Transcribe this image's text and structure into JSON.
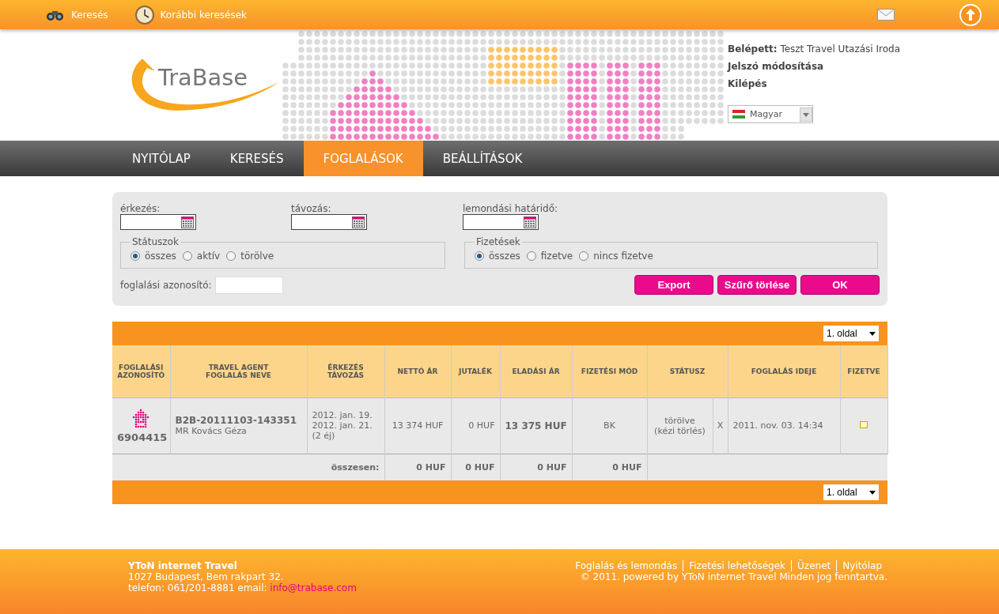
{
  "topbar": {
    "links": [
      {
        "label": "Keresés",
        "kind": "binoculars"
      },
      {
        "label": "Korábbi keresések",
        "kind": "clock"
      }
    ]
  },
  "header": {
    "logo": "TraBase",
    "logged_in_label": "Belépett:",
    "logged_in_user": "Teszt Travel Utazási Iroda",
    "links": [
      "Jelszó módosítása",
      "Kilépés"
    ],
    "language": "Magyar"
  },
  "nav": [
    {
      "label": "NYITÓLAP",
      "selected": false
    },
    {
      "label": "KERESÉS",
      "selected": false
    },
    {
      "label": "FOGLALÁSOK",
      "selected": true
    },
    {
      "label": "BEÁLLÍTÁSOK",
      "selected": false
    }
  ],
  "filters": {
    "dates": [
      {
        "label": "érkezés:"
      },
      {
        "label": "távozás:"
      },
      {
        "label": "lemondási határidő:"
      }
    ],
    "groups": [
      {
        "legend": "Státuszok",
        "options": [
          {
            "label": "összes",
            "selected": true
          },
          {
            "label": "aktív",
            "selected": false
          },
          {
            "label": "törölve",
            "selected": false
          }
        ]
      },
      {
        "legend": "Fizetések",
        "options": [
          {
            "label": "összes",
            "selected": true
          },
          {
            "label": "fizetve",
            "selected": false
          },
          {
            "label": "nincs fizetve",
            "selected": false
          }
        ]
      }
    ],
    "id_label": "foglalási azonosító:",
    "buttons": [
      "Export",
      "Szűrő törlése",
      "OK"
    ]
  },
  "pager": {
    "top": "1. oldal",
    "bottom": "1. oldal"
  },
  "table": {
    "columns": [
      [
        "FOGLALÁSI",
        "AZONOSÍTÓ"
      ],
      [
        "TRAVEL AGENT",
        "FOGLALÁS NEVE"
      ],
      [
        "ÉRKEZÉS",
        "TÁVOZÁS"
      ],
      [
        "NETTÓ ÁR"
      ],
      [
        "JUTALÉK"
      ],
      [
        "ELADÁSI ÁR"
      ],
      [
        "FIZETÉSI MÓD"
      ],
      [
        "STÁTUSZ"
      ],
      [
        "FOGLALÁS IDEJE"
      ],
      [
        "FIZETVE"
      ]
    ],
    "rows": [
      {
        "id": "6904415",
        "code": "B2B-20111103-143351",
        "name": "MR Kovács Géza",
        "dates": [
          "2012. jan. 19.",
          "2012. jan. 21.",
          "(2 éj)"
        ],
        "net": "13 374 HUF",
        "commission": "0 HUF",
        "sale": "13 375 HUF",
        "payment": "BK",
        "status": [
          "törölve",
          "(kézi törlés)"
        ],
        "mark": "X",
        "booked": "2011. nov. 03. 14:34",
        "paid": false
      }
    ],
    "totals": {
      "label": "összesen:",
      "values": [
        "0 HUF",
        "0 HUF",
        "0 HUF",
        "0 HUF"
      ]
    }
  },
  "footer": {
    "company": "YToN internet Travel",
    "address": "1027 Budapest, Bem rakpart 32.",
    "contact": "telefon: 061/201-8881 email:",
    "email": "info@trabase.com",
    "links": [
      "Foglalás és lemondás",
      "Fizetési lehetőségek",
      "Üzenet",
      "Nyitólap"
    ],
    "copyright": "© 2011. powered by YToN internet Travel Minden jog fenntartva."
  }
}
